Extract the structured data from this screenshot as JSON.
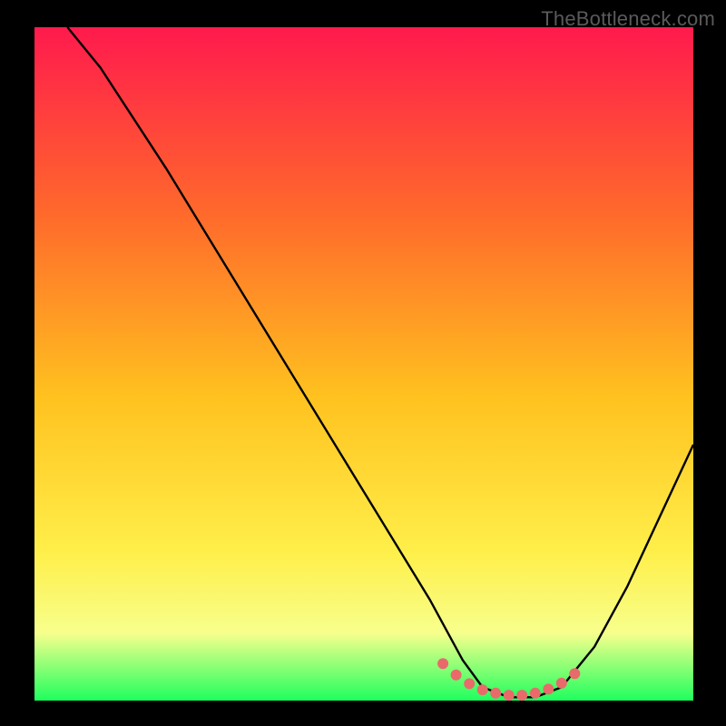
{
  "watermark": "TheBottleneck.com",
  "colors": {
    "background": "#000000",
    "gradient_top": "#ff1a4d",
    "gradient_upper_mid": "#ff6a2b",
    "gradient_mid": "#ffc21f",
    "gradient_lower_mid": "#ffef4a",
    "gradient_lower": "#f7ff8c",
    "gradient_bottom": "#1eff5e",
    "curve": "#000000",
    "highlight_dots": "#e96a6a"
  },
  "chart_data": {
    "type": "line",
    "title": "",
    "xlabel": "",
    "ylabel": "",
    "xlim": [
      0,
      100
    ],
    "ylim": [
      0,
      100
    ],
    "series": [
      {
        "name": "bottleneck-curve",
        "x": [
          5,
          10,
          20,
          30,
          40,
          50,
          60,
          65,
          68,
          72,
          76,
          80,
          85,
          90,
          100
        ],
        "y": [
          100,
          94,
          79,
          63,
          47,
          31,
          15,
          6,
          2,
          0.5,
          0.5,
          2,
          8,
          17,
          38
        ]
      }
    ],
    "highlight_points": {
      "name": "optimal-zone-dots",
      "x": [
        62,
        64,
        66,
        68,
        70,
        72,
        74,
        76,
        78,
        80,
        82
      ],
      "y": [
        5.5,
        3.8,
        2.5,
        1.6,
        1.1,
        0.8,
        0.8,
        1.1,
        1.7,
        2.6,
        4.0
      ]
    },
    "gradient_bands": [
      {
        "stop": 0.0,
        "color": "#ff1a4d"
      },
      {
        "stop": 0.28,
        "color": "#ff6a2b"
      },
      {
        "stop": 0.55,
        "color": "#ffc21f"
      },
      {
        "stop": 0.78,
        "color": "#ffef4a"
      },
      {
        "stop": 0.9,
        "color": "#f7ff8c"
      },
      {
        "stop": 1.0,
        "color": "#1eff5e"
      }
    ]
  }
}
